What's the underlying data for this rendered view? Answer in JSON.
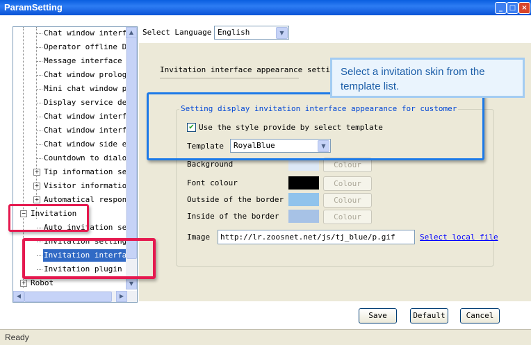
{
  "window": {
    "title": "ParamSetting",
    "min": "_",
    "max": "□",
    "close": "×"
  },
  "tree": {
    "items": [
      {
        "label": "Chat window interface",
        "indent": 2
      },
      {
        "label": "Operator offline Display",
        "indent": 2
      },
      {
        "label": "Message interface setting",
        "indent": 2
      },
      {
        "label": "Chat window prologue",
        "indent": 2
      },
      {
        "label": "Mini chat window prologue",
        "indent": 2
      },
      {
        "label": "Display service department",
        "indent": 2
      },
      {
        "label": "Chat window interface",
        "indent": 2
      },
      {
        "label": "Chat window interface",
        "indent": 2
      },
      {
        "label": "Chat window side edge",
        "indent": 2
      },
      {
        "label": "Countdown to dialog",
        "indent": 2
      },
      {
        "label": "Tip information setting",
        "indent": 1,
        "expander": "+"
      },
      {
        "label": "Visitor information",
        "indent": 1,
        "expander": "+"
      },
      {
        "label": "Automatical response",
        "indent": 1,
        "expander": "+"
      },
      {
        "label": "Invitation",
        "indent": 0,
        "expander": "−"
      },
      {
        "label": "Auto invitation setting",
        "indent": 2
      },
      {
        "label": "Invitation setting",
        "indent": 2
      },
      {
        "label": "Invitation interface",
        "indent": 2,
        "selected": true
      },
      {
        "label": "Invitation plugin",
        "indent": 2
      },
      {
        "label": "Robot",
        "indent": 0,
        "expander": "+"
      }
    ]
  },
  "language": {
    "label": "Select Language",
    "value": "English"
  },
  "appearance": {
    "heading": "Invitation interface appearance setting:"
  },
  "callout": {
    "text": "Select a invitation skin from the template list."
  },
  "group": {
    "title": "Setting display invitation interface appearance for customer",
    "use_template_label": "Use the style provide by select template",
    "use_template_checked": true,
    "template_label": "Template",
    "template_value": "RoyalBlue"
  },
  "colors": {
    "rows": [
      {
        "label": "Background",
        "swatch": "#dde8f6",
        "button": "Colour"
      },
      {
        "label": "Font colour",
        "swatch": "#000000",
        "button": "Colour"
      },
      {
        "label": "Outside of the border",
        "swatch": "#90c3ec",
        "button": "Colour"
      },
      {
        "label": "Inside of the border",
        "swatch": "#a7c2e6",
        "button": "Colour"
      }
    ]
  },
  "image": {
    "label": "Image",
    "value": "http://lr.zoosnet.net/js/tj_blue/p.gif",
    "link": "Select local file"
  },
  "buttons": {
    "save": "Save",
    "default": "Default",
    "cancel": "Cancel"
  },
  "status": {
    "text": "Ready"
  }
}
